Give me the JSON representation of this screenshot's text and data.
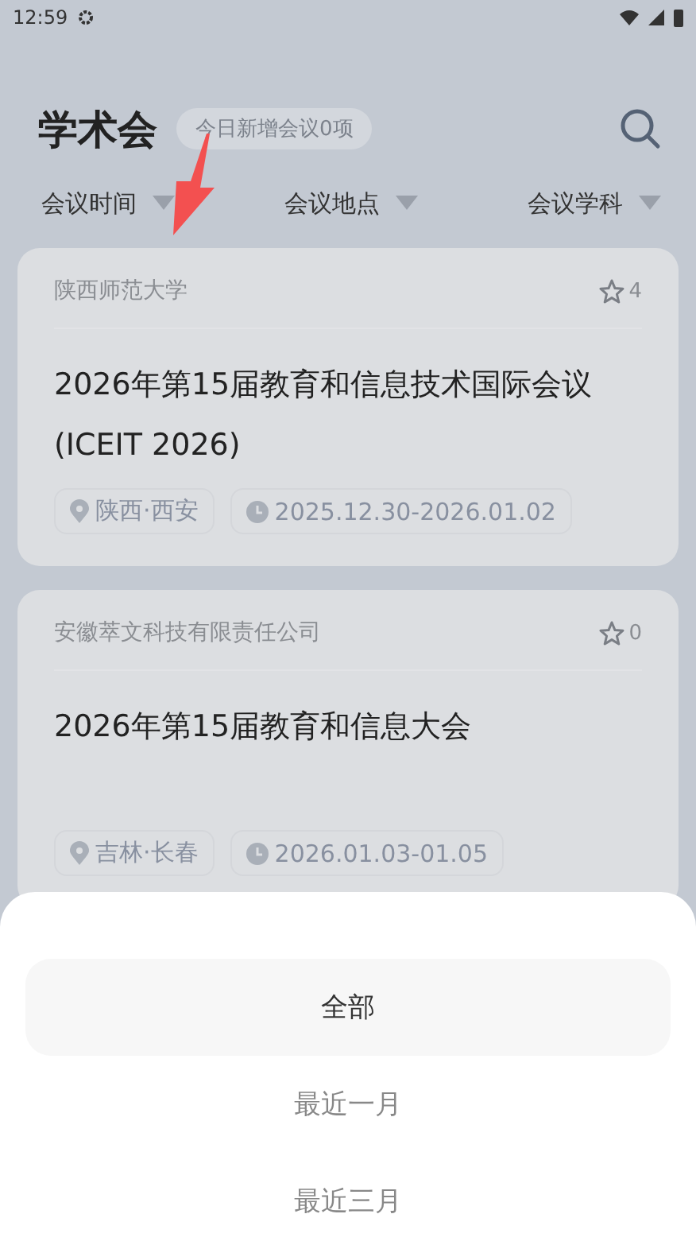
{
  "status_bar": {
    "time": "12:59"
  },
  "header": {
    "title": "学术会",
    "badge": "今日新增会议0项"
  },
  "filters": [
    {
      "label": "会议时间"
    },
    {
      "label": "会议地点"
    },
    {
      "label": "会议学科"
    }
  ],
  "conferences": [
    {
      "organizer": "陕西师范大学",
      "stars": "4",
      "title": "2026年第15届教育和信息技术国际会议(ICEIT 2026)",
      "location": "陕西·西安",
      "dates": "2025.12.30-2026.01.02"
    },
    {
      "organizer": "安徽萃文科技有限责任公司",
      "stars": "0",
      "title": "2026年第15届教育和信息大会",
      "location": "吉林·长春",
      "dates": "2026.01.03-01.05"
    }
  ],
  "sheet": {
    "options": [
      {
        "label": "全部",
        "selected": true
      },
      {
        "label": "最近一月",
        "selected": false
      },
      {
        "label": "最近三月",
        "selected": false
      }
    ]
  }
}
